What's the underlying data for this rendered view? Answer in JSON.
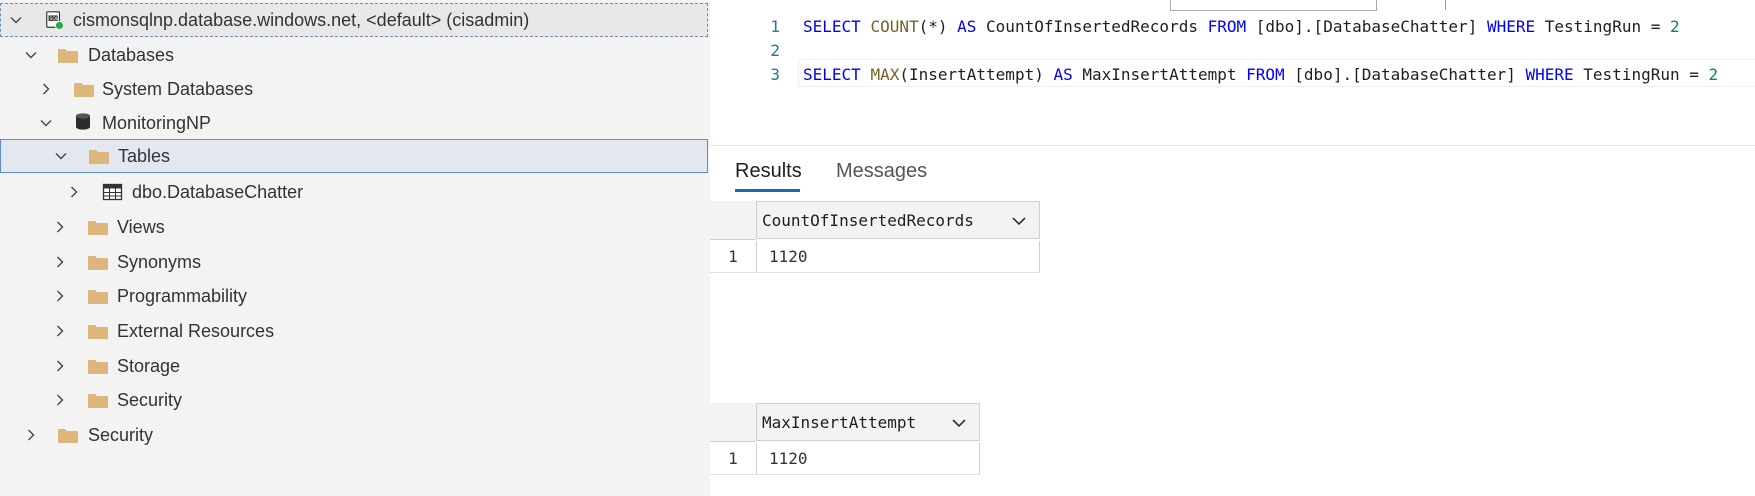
{
  "explorer": {
    "server": "cismonsqlnp.database.windows.net, <default> (cisadmin)",
    "databases": "Databases",
    "system_databases": "System Databases",
    "database_name": "MonitoringNP",
    "tables": "Tables",
    "table_item": "dbo.DatabaseChatter",
    "views": "Views",
    "synonyms": "Synonyms",
    "programmability": "Programmability",
    "external_resources": "External Resources",
    "storage": "Storage",
    "db_security": "Security",
    "server_security": "Security"
  },
  "editor": {
    "line_numbers": [
      "1",
      "2",
      "3"
    ],
    "line1": {
      "kw1": "SELECT",
      "fn1": "COUNT",
      "t1": "(*) ",
      "kw2": "AS",
      "t2": " CountOfInsertedRecords ",
      "kw3": "FROM",
      "t3": " [dbo].[DatabaseChatter] ",
      "kw4": "WHERE",
      "t4": " TestingRun = ",
      "num": "2"
    },
    "line3": {
      "kw1": "SELECT",
      "fn1": "MAX",
      "t1": "(InsertAttempt) ",
      "kw2": "AS",
      "t2": " MaxInsertAttempt ",
      "kw3": "FROM",
      "t3": " [dbo].[DatabaseChatter] ",
      "kw4": "WHERE",
      "t4": " TestingRun = ",
      "num": "2"
    }
  },
  "results": {
    "tabs": {
      "results": "Results",
      "messages": "Messages"
    },
    "grid1": {
      "column": "CountOfInsertedRecords",
      "row_number": "1",
      "value": "1120"
    },
    "grid2": {
      "column": "MaxInsertAttempt",
      "row_number": "1",
      "value": "1120"
    }
  },
  "colors": {
    "keyword": "#0000ff",
    "function": "#795e26",
    "number": "#098658",
    "line_number": "#237893",
    "tab_accent": "#0f6cbd",
    "folder": "#dcb67a"
  }
}
